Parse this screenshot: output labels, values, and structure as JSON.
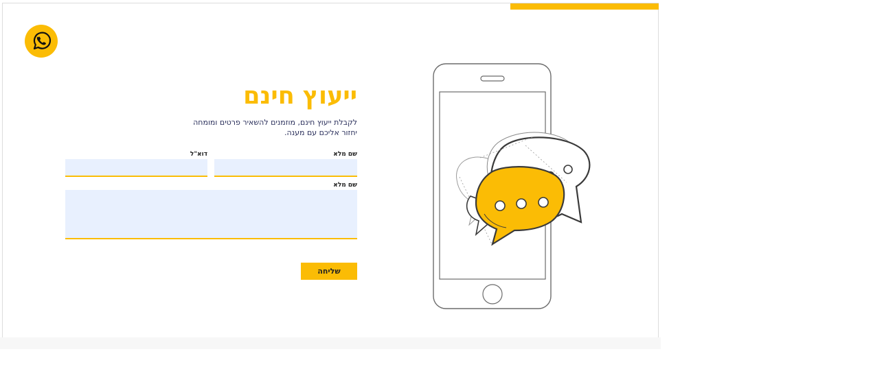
{
  "colors": {
    "accent": "#fbbc05",
    "field_bg": "#e8f0fe",
    "text_dark": "#2a2f5b"
  },
  "whatsapp": {
    "icon": "whatsapp-icon"
  },
  "form": {
    "title": "ייעוץ חינם",
    "subtitle": "לקבלת ייעוץ חינם, מוזמנים להשאיר פרטים ומומחה יחזור אליכם עם מענה.",
    "fields": {
      "full_name_label": "שם מלא",
      "email_label": "דוא\"ל",
      "message_label": "שם מלא"
    },
    "submit_label": "שליחה"
  },
  "illustration": {
    "icon": "phone-chat-bubbles-illustration"
  }
}
